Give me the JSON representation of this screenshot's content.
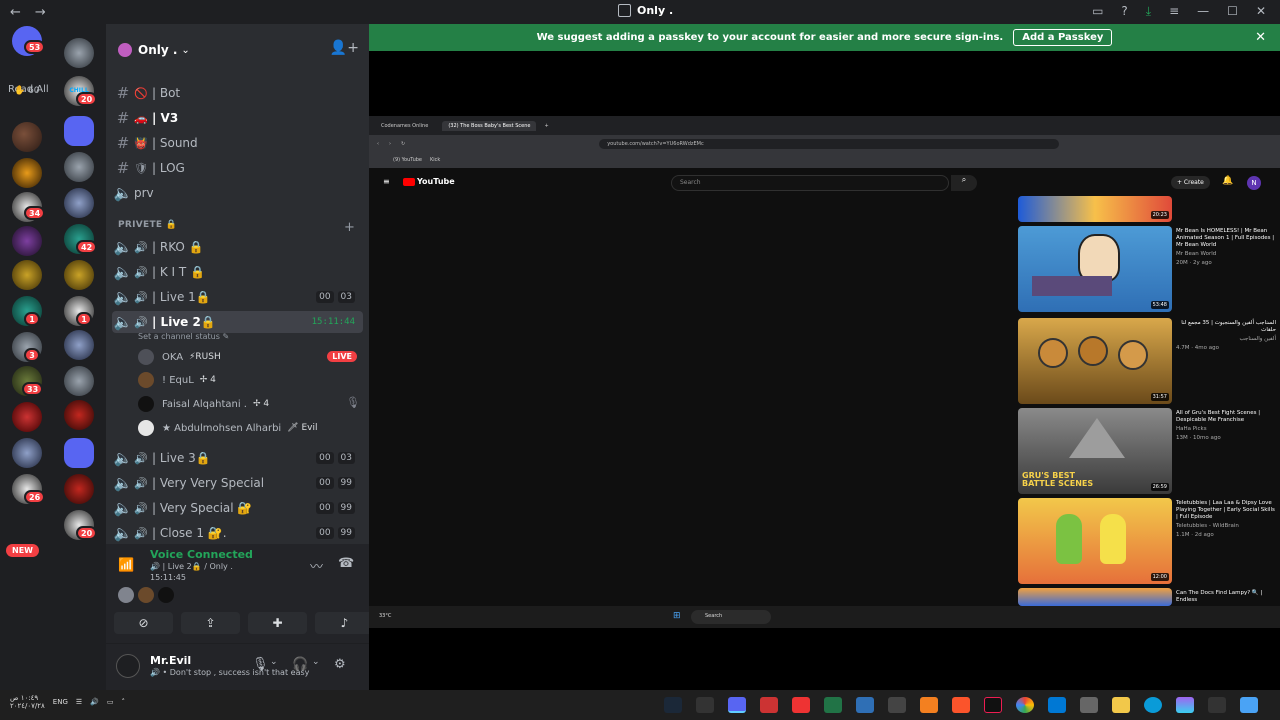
{
  "window": {
    "title": "Only .",
    "nav_back": "←",
    "nav_fwd": "→"
  },
  "rail": {
    "read_all": "Read All",
    "home_badge": "53",
    "dm_count": "60",
    "new_label": "NEW",
    "badges": [
      "20",
      "34",
      "42",
      "1",
      "1",
      "3",
      "33",
      "26",
      "20"
    ],
    "chill_label": "CHILL"
  },
  "guild": {
    "name": "Only .",
    "chevron": "⌄"
  },
  "channels": {
    "text": [
      {
        "icon": "🚫",
        "label": "| Bot",
        "active": false
      },
      {
        "icon": "🚗",
        "label": "| V3",
        "active": true
      },
      {
        "icon": "👹",
        "label": "| Sound",
        "active": false
      },
      {
        "icon": "🛡",
        "label": "| LOG",
        "active": false
      },
      {
        "icon": "",
        "label": "prv",
        "active": false
      }
    ],
    "category": "PRIVETE 🔒",
    "voice": [
      {
        "label": "| RKO 🔒",
        "c1": "",
        "c2": ""
      },
      {
        "label": "| K I T 🔒",
        "c1": "",
        "c2": ""
      },
      {
        "label": "| Live 1🔒",
        "c1": "00",
        "c2": "03"
      },
      {
        "label": "| Live 2🔒",
        "time": "15:11:44"
      },
      {
        "label": "| Live 3🔒",
        "c1": "00",
        "c2": "03"
      },
      {
        "label": "| Very Very Special",
        "c1": "00",
        "c2": "99"
      },
      {
        "label": "| Very Special 🔐",
        "c1": "00",
        "c2": "99"
      },
      {
        "label": "| Close 1 🔐.",
        "c1": "00",
        "c2": "99"
      }
    ],
    "status_hint": "Set a channel status ✎",
    "members": [
      {
        "name": "OKA",
        "tag": "⚡RUSH",
        "live": "LIVE"
      },
      {
        "name": "! EquL",
        "tag": "✢ 4"
      },
      {
        "name": "Faisal Alqahtani .",
        "tag": "✢ 4"
      },
      {
        "name": "★ Abdulmohsen Alharbi",
        "tag": "🗡 Evil"
      }
    ]
  },
  "voice_panel": {
    "status": "Voice Connected",
    "sub": "🔊 | Live 2🔒 / Only .",
    "elapsed": "15:11:45"
  },
  "user_panel": {
    "name": "Mr.Evil",
    "status": "🔊 • Don't stop , success isn't that easy"
  },
  "passkey": {
    "text": "We suggest adding a passkey to your account for easier and more secure sign-ins.",
    "button": "Add a Passkey",
    "close": "✕"
  },
  "browser": {
    "tabs": [
      "Codenames Online",
      "(32) The Boss Baby's Best Scene"
    ],
    "url": "youtube.com/watch?v=YU6oRWdzEMc",
    "bookmarks": [
      "(9) YouTube",
      "Kick"
    ],
    "yt": {
      "logo": "YouTube",
      "search_placeholder": "Search",
      "create": "+ Create",
      "avatar": "N"
    },
    "videos": [
      {
        "dur": "20:23",
        "title": "",
        "channel": "",
        "meta": ""
      },
      {
        "dur": "53:48",
        "title": "Mr Bean Is HOMELESS! | Mr Bean Animated Season 1 | Full Episodes | Mr Bean World",
        "channel": "Mr Bean World",
        "meta": "20M · 2y ago"
      },
      {
        "dur": "31:57",
        "title": "السناجب ألفين والسنجبوت | 35 مجمع لنا حلقات",
        "channel": "ألفين والسناجب",
        "meta": "4.7M · 4mo ago"
      },
      {
        "dur": "26:59",
        "title": "All of Gru's Best Fight Scenes | Despicable Me Franchise",
        "channel": "HaHa Picks",
        "meta": "13M · 10mo ago"
      },
      {
        "dur": "12:00",
        "title": "Teletubbies | Laa Laa & Dipsy Love Playing Together | Early Social Skills | Full Episode",
        "channel": "Teletubbies - WildBrain",
        "meta": "1.1M · 2d ago"
      },
      {
        "dur": "",
        "title": "Can The Docs Find Lampy? 🔍 | Endless",
        "channel": "",
        "meta": ""
      }
    ],
    "gru_caption": "GRU'S BEST BATTLE SCENES",
    "taskbar": {
      "search": "Search",
      "weather": "33°C"
    }
  },
  "taskbar": {
    "lang": "ENG",
    "date": "١٠:٤٩ ص",
    "date2": "٢٠٢٤/٠٧/٢٨"
  }
}
